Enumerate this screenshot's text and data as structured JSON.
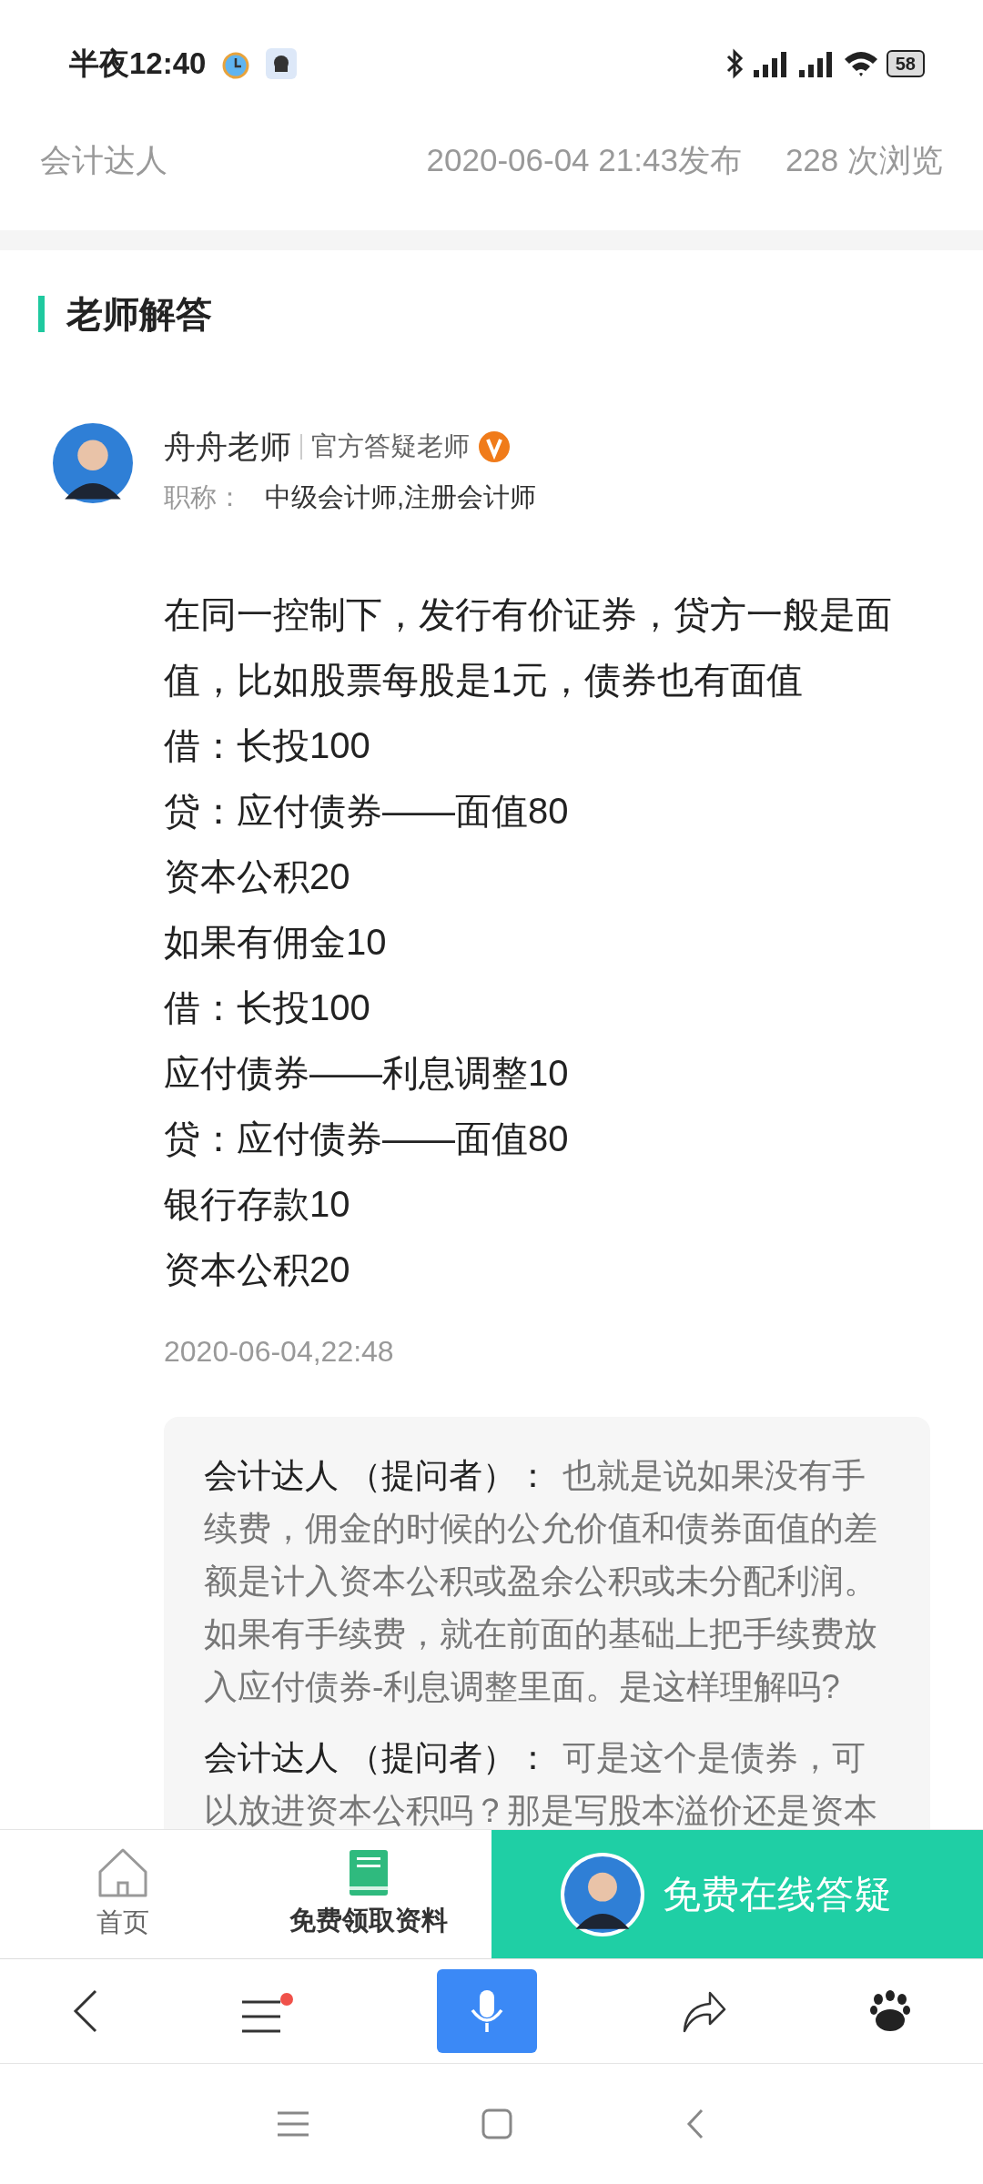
{
  "status_bar": {
    "time": "半夜12:40",
    "battery": "58"
  },
  "article_meta": {
    "author": "会计达人",
    "published": "2020-06-04 21:43发布",
    "views": "228 次浏览"
  },
  "section": {
    "title": "老师解答"
  },
  "teacher": {
    "name": "舟舟老师",
    "role": "官方答疑老师",
    "verified": true,
    "title_label": "职称：",
    "title_value": "中级会计师,注册会计师"
  },
  "answer": {
    "lines": [
      "在同一控制下，发行有价证券，贷方一般是面值，比如股票每股是1元，债券也有面值",
      "借：长投100",
      "贷：应付债券——面值80",
      "资本公积20",
      "如果有佣金10",
      "借：长投100",
      "应付债券——利息调整10",
      "贷：应付债券——面值80",
      "银行存款10",
      "资本公积20"
    ],
    "time": "2020-06-04,22:48"
  },
  "comments": [
    {
      "author": "会计达人 （提问者）：",
      "text": "也就是说如果没有手续费，佣金的时候的公允价值和债券面值的差额是计入资本公积或盈余公积或未分配利润。如果有手续费，就在前面的基础上把手续费放入应付债券-利息调整里面。是这样理解吗?"
    },
    {
      "author": "会计达人 （提问者）：",
      "text": "可是这个是债券，可以放进资本公积吗？那是写股本溢价还是资本"
    }
  ],
  "bottom_bar": {
    "home": "首页",
    "materials": "免费领取资料",
    "consult": "免费在线答疑"
  },
  "browser_toolbar": {
    "menu_badge": true
  }
}
